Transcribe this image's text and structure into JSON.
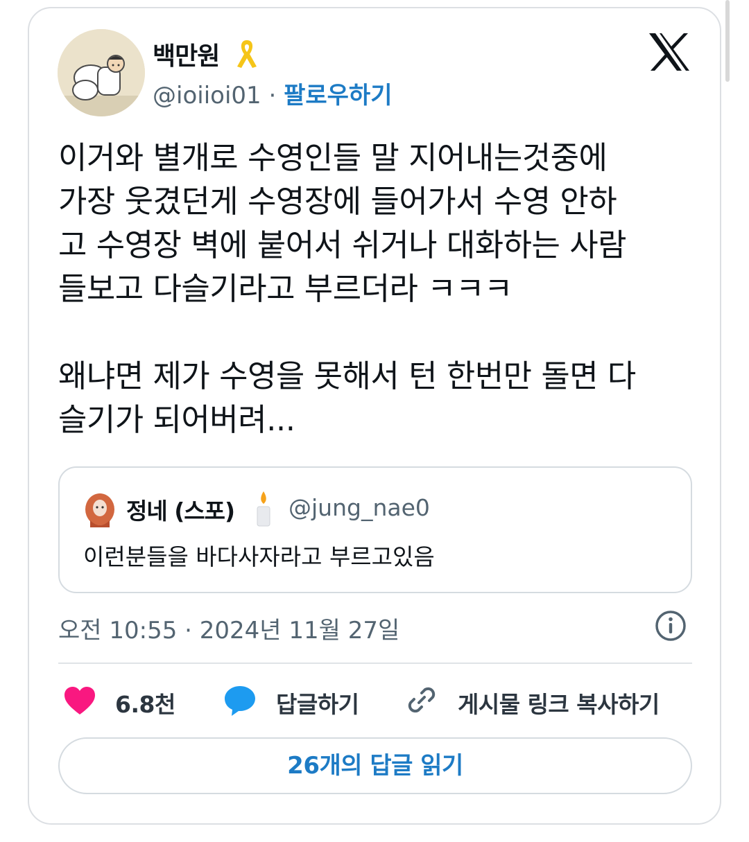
{
  "tweet": {
    "author_name": "백만원",
    "author_handle": "@ioiioi01",
    "separator": "·",
    "follow_label": "팔로우하기",
    "text": "이거와 별개로 수영인들 말 지어내는것중에\n가장 웃겼던게 수영장에 들어가서 수영 안하\n고 수영장 벽에 붙어서 쉬거나 대화하는 사람\n들보고 다슬기라고 부르더라 ㅋㅋㅋ\n\n왜냐면 제가 수영을 못해서 턴 한번만 돌면 다\n슬기가 되어버려...",
    "timestamp": "오전 10:55 · 2024년 11월 27일"
  },
  "quote": {
    "author_name": "정네 (스포)",
    "author_handle": "@jung_nae0",
    "text": "이런분들을 바다사자라고 부르고있음"
  },
  "actions": {
    "like_count": "6.8천",
    "reply_label": "답글하기",
    "copy_link_label": "게시물 링크 복사하기"
  },
  "read_replies_label": "26개의 답글 읽기",
  "colors": {
    "follow_blue": "#1d7bc5",
    "like_pink": "#f91880",
    "reply_blue": "#1d9bf0",
    "secondary_text": "#536471",
    "ribbon_yellow": "#f5c518"
  },
  "icons": [
    "x-logo-icon",
    "yellow-ribbon-icon",
    "candle-icon",
    "info-icon",
    "heart-icon",
    "reply-bubble-icon",
    "link-icon"
  ]
}
